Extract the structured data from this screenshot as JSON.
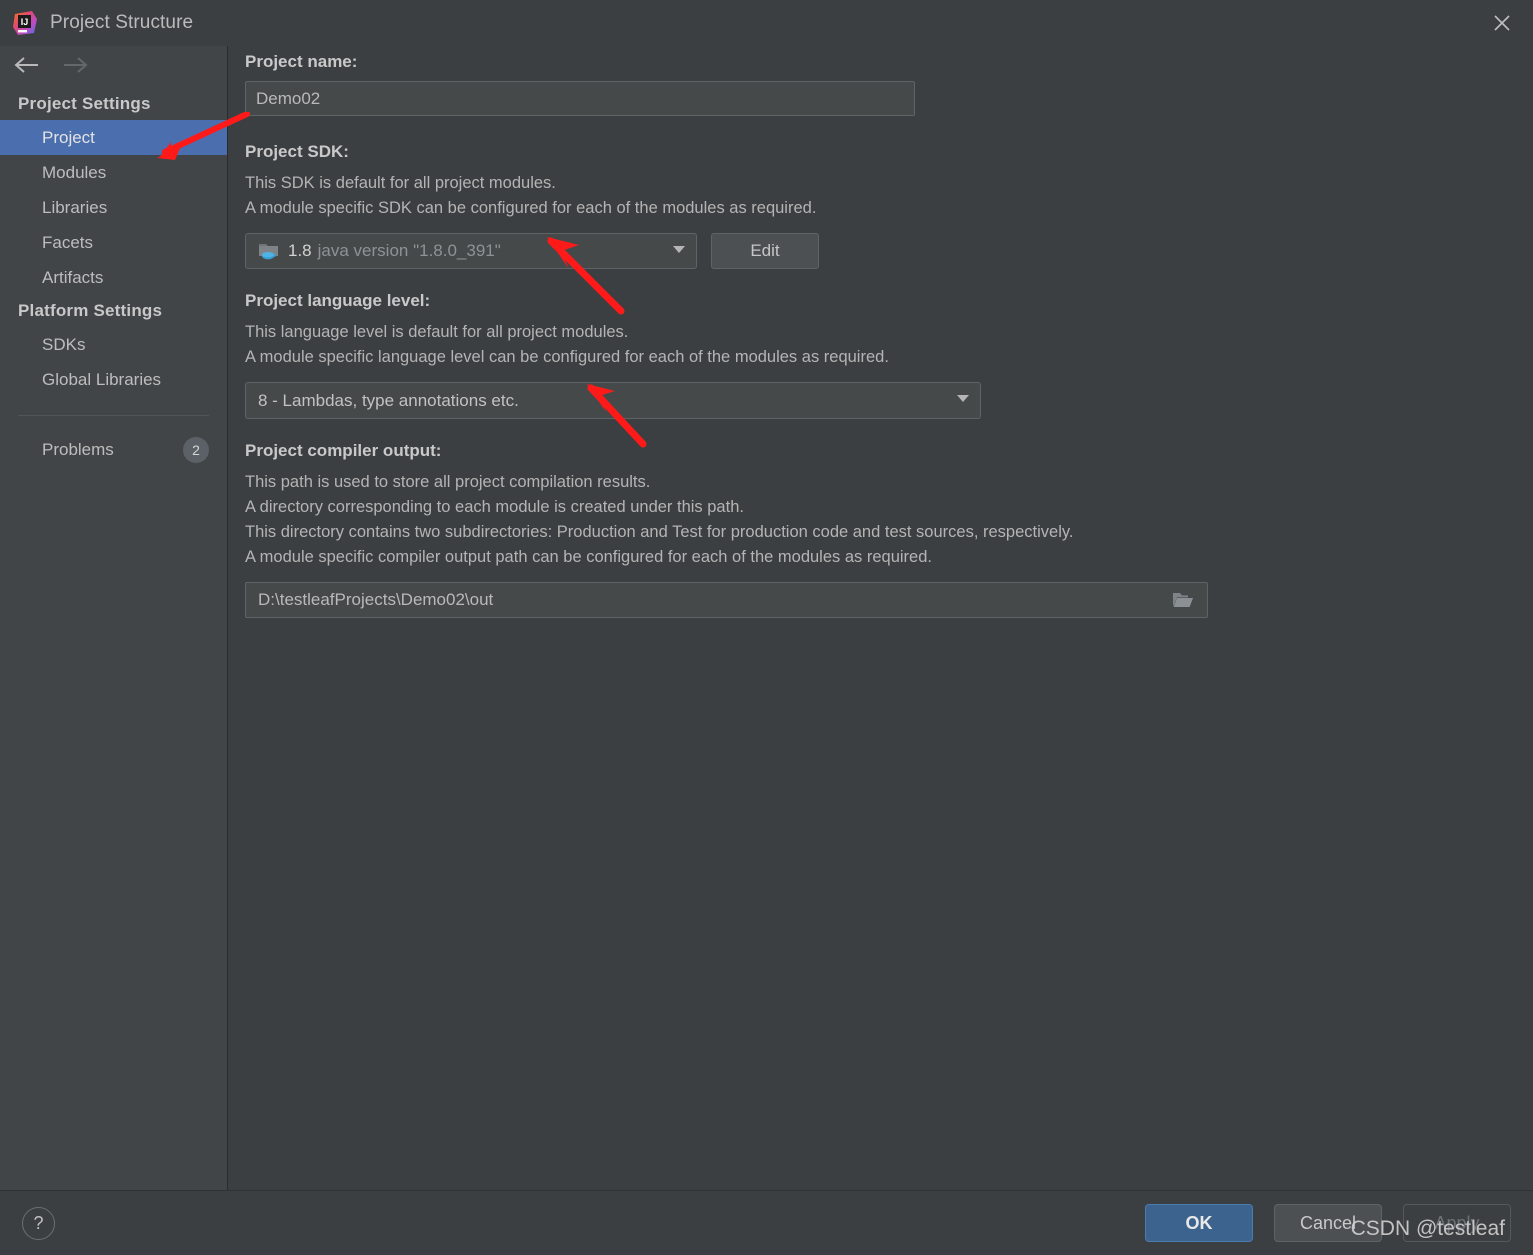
{
  "window": {
    "title": "Project Structure",
    "logo_icon": "intellij-idea-logo",
    "close_icon": "close-icon"
  },
  "sidebar": {
    "back_icon": "arrow-left-icon",
    "forward_icon": "arrow-right-icon",
    "groups": [
      {
        "header": "Project Settings",
        "items": [
          {
            "label": "Project",
            "selected": true
          },
          {
            "label": "Modules",
            "selected": false
          },
          {
            "label": "Libraries",
            "selected": false
          },
          {
            "label": "Facets",
            "selected": false
          },
          {
            "label": "Artifacts",
            "selected": false
          }
        ]
      },
      {
        "header": "Platform Settings",
        "items": [
          {
            "label": "SDKs",
            "selected": false
          },
          {
            "label": "Global Libraries",
            "selected": false
          }
        ]
      }
    ],
    "problems": {
      "label": "Problems",
      "count": "2"
    }
  },
  "main": {
    "project_name": {
      "title": "Project name:",
      "value": "Demo02"
    },
    "project_sdk": {
      "title": "Project SDK:",
      "desc_line1": "This SDK is default for all project modules.",
      "desc_line2": "A module specific SDK can be configured for each of the modules as required.",
      "icon": "java-sdk-folder-icon",
      "version": "1.8",
      "version_desc": "java version \"1.8.0_391\"",
      "dropdown_icon": "chevron-down-icon",
      "edit_label": "Edit"
    },
    "language_level": {
      "title": "Project language level:",
      "desc_line1": "This language level is default for all project modules.",
      "desc_line2": "A module specific language level can be configured for each of the modules as required.",
      "value": "8 - Lambdas, type annotations etc.",
      "dropdown_icon": "chevron-down-icon"
    },
    "compiler_output": {
      "title": "Project compiler output:",
      "desc_line1": "This path is used to store all project compilation results.",
      "desc_line2": "A directory corresponding to each module is created under this path.",
      "desc_line3": "This directory contains two subdirectories: Production and Test for production code and test sources, respectively.",
      "desc_line4": "A module specific compiler output path can be configured for each of the modules as required.",
      "path": "D:\\testleafProjects\\Demo02\\out",
      "browse_icon": "folder-open-icon"
    }
  },
  "footer": {
    "help_label": "?",
    "ok_label": "OK",
    "cancel_label": "Cancel",
    "apply_label": "Apply"
  },
  "watermark": "CSDN @testleaf",
  "colors": {
    "selection": "#4B6EAF",
    "annotation_arrow": "#FF1A1A",
    "primary_button": "#3C638E",
    "background": "#3C3F41",
    "sidebar_background": "#414547"
  }
}
